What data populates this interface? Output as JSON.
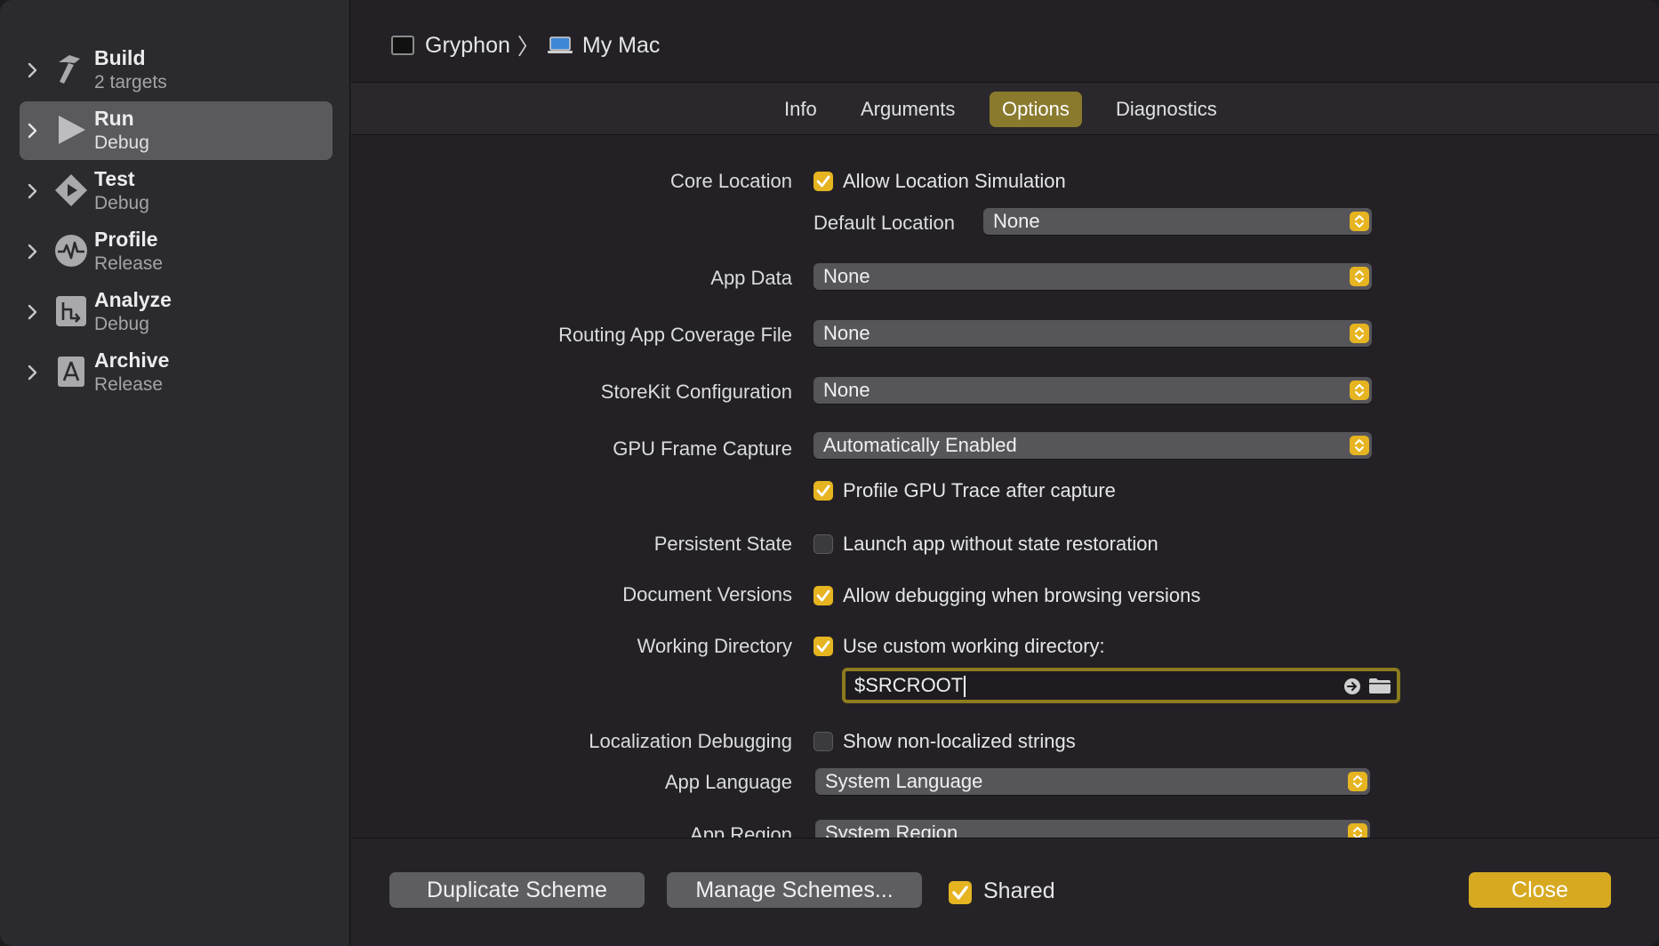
{
  "sidebar": {
    "items": [
      {
        "title": "Build",
        "subtitle": "2 targets",
        "icon": "hammer-icon"
      },
      {
        "title": "Run",
        "subtitle": "Debug",
        "icon": "play-icon",
        "selected": true
      },
      {
        "title": "Test",
        "subtitle": "Debug",
        "icon": "test-diamond-icon"
      },
      {
        "title": "Profile",
        "subtitle": "Release",
        "icon": "waveform-icon"
      },
      {
        "title": "Analyze",
        "subtitle": "Debug",
        "icon": "analyze-icon"
      },
      {
        "title": "Archive",
        "subtitle": "Release",
        "icon": "archive-icon"
      }
    ]
  },
  "header": {
    "scheme": "Gryphon",
    "separator": "〉",
    "destination": "My Mac"
  },
  "tabs": [
    {
      "label": "Info"
    },
    {
      "label": "Arguments"
    },
    {
      "label": "Options",
      "active": true
    },
    {
      "label": "Diagnostics"
    }
  ],
  "options": {
    "core_location": {
      "label": "Core Location",
      "checkbox": "Allow Location Simulation",
      "checked": true
    },
    "default_location": {
      "label": "Default Location",
      "value": "None"
    },
    "app_data": {
      "label": "App Data",
      "value": "None"
    },
    "routing": {
      "label": "Routing App Coverage File",
      "value": "None"
    },
    "storekit": {
      "label": "StoreKit Configuration",
      "value": "None"
    },
    "gpu_capture": {
      "label": "GPU Frame Capture",
      "value": "Automatically Enabled"
    },
    "gpu_trace": {
      "checkbox": "Profile GPU Trace after capture",
      "checked": true
    },
    "persistent_state": {
      "label": "Persistent State",
      "checkbox": "Launch app without state restoration",
      "checked": false
    },
    "document_versions": {
      "label": "Document Versions",
      "checkbox": "Allow debugging when browsing versions",
      "checked": true
    },
    "working_directory": {
      "label": "Working Directory",
      "checkbox": "Use custom working directory:",
      "checked": true,
      "path": "$SRCROOT"
    },
    "localization_debugging": {
      "label": "Localization Debugging",
      "checkbox": "Show non-localized strings",
      "checked": false
    },
    "app_language": {
      "label": "App Language",
      "value": "System Language"
    },
    "app_region": {
      "label": "App Region",
      "value": "System Region"
    }
  },
  "footer": {
    "duplicate": "Duplicate Scheme",
    "manage": "Manage Schemes...",
    "shared": "Shared",
    "shared_checked": true,
    "close": "Close"
  },
  "colors": {
    "accent": "#e5b420",
    "selected_tab": "#8a7a2e",
    "primary_button": "#d6a921"
  }
}
